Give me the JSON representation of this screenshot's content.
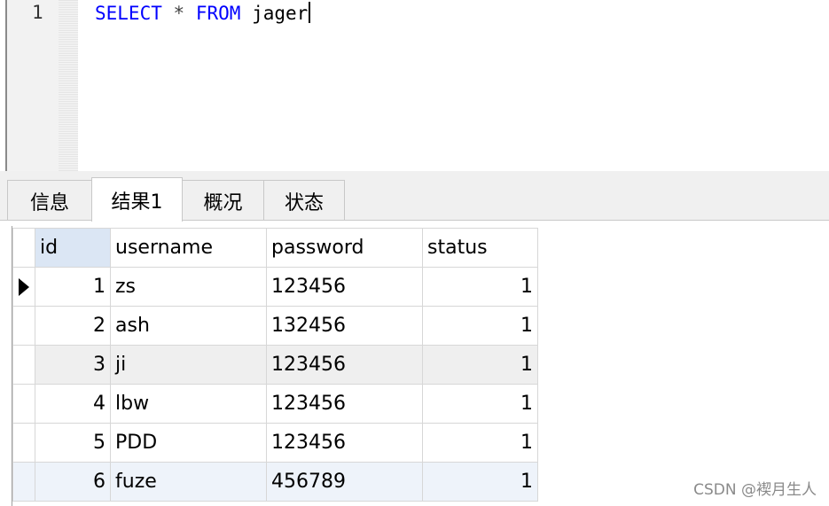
{
  "editor": {
    "line_number": "1",
    "tokens": {
      "kw_select": "SELECT",
      "star": "*",
      "kw_from": "FROM",
      "table": "jager"
    },
    "keyword_color": "#0000ff"
  },
  "tabs": [
    {
      "label": "信息",
      "active": false
    },
    {
      "label": "结果1",
      "active": true
    },
    {
      "label": "概况",
      "active": false
    },
    {
      "label": "状态",
      "active": false
    }
  ],
  "grid": {
    "columns": [
      "id",
      "username",
      "password",
      "status"
    ],
    "current_row_indicator": "arrow-right",
    "rows": [
      {
        "id": "1",
        "username": "zs",
        "password": "123456",
        "status": "1"
      },
      {
        "id": "2",
        "username": "ash",
        "password": "132456",
        "status": "1"
      },
      {
        "id": "3",
        "username": "ji",
        "password": "123456",
        "status": "1"
      },
      {
        "id": "4",
        "username": "lbw",
        "password": "123456",
        "status": "1"
      },
      {
        "id": "5",
        "username": "PDD",
        "password": "123456",
        "status": "1"
      },
      {
        "id": "6",
        "username": "fuze",
        "password": "456789",
        "status": "1"
      }
    ]
  },
  "watermark": "CSDN @褉月生人"
}
